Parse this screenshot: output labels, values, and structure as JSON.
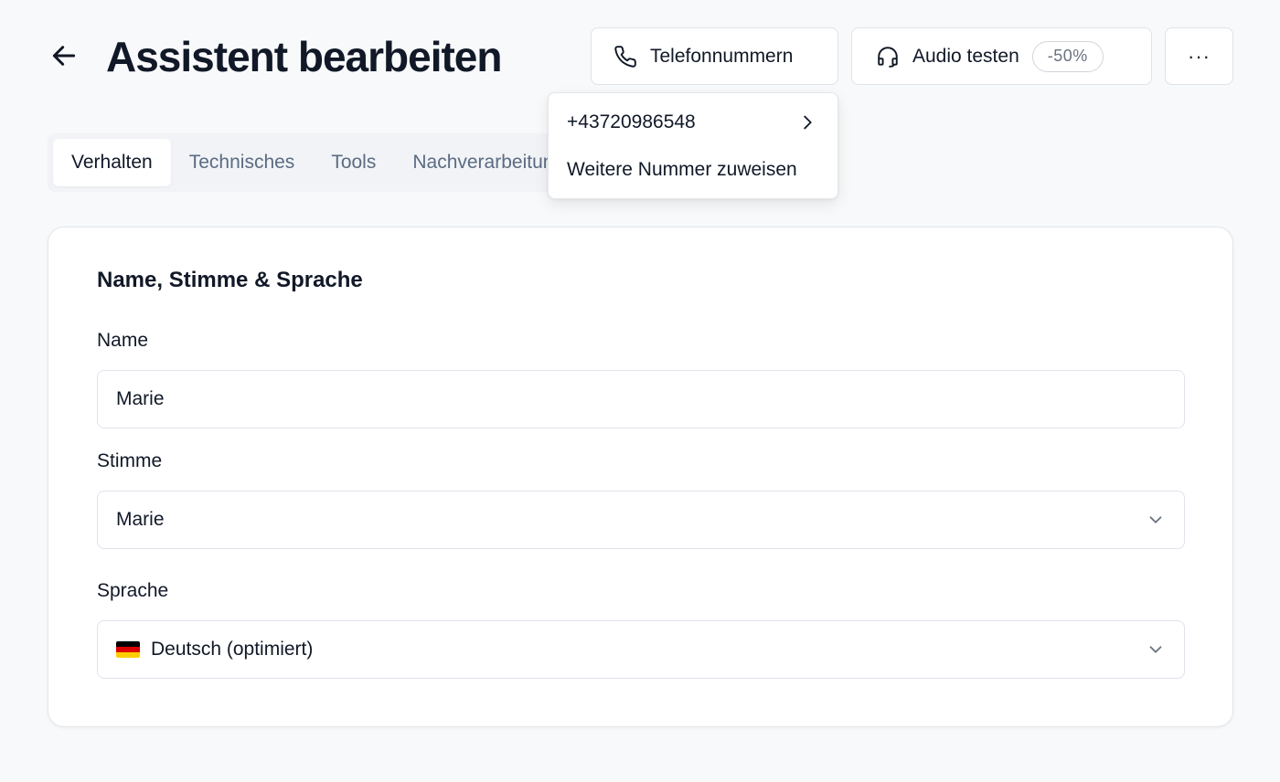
{
  "header": {
    "title": "Assistent bearbeiten",
    "back_icon": "arrow-left-icon",
    "phone_button": {
      "label": "Telefonnummern",
      "icon": "phone-icon"
    },
    "audio_button": {
      "label": "Audio testen",
      "icon": "headphones-icon",
      "badge": "-50%"
    },
    "more_button": {
      "label": "···",
      "icon": "ellipsis-icon"
    }
  },
  "tabs": [
    {
      "label": "Verhalten",
      "active": true
    },
    {
      "label": "Technisches"
    },
    {
      "label": "Tools"
    },
    {
      "label": "Nachverarbeitung"
    }
  ],
  "phone_dropdown": {
    "items": [
      {
        "label": "+43720986548",
        "icon": "chevron-right-icon"
      },
      {
        "label": "Weitere Nummer zuweisen"
      }
    ]
  },
  "card": {
    "title": "Name, Stimme & Sprache",
    "fields": {
      "name": {
        "label": "Name",
        "value": "Marie"
      },
      "voice": {
        "label": "Stimme",
        "value": "Marie",
        "icon": "chevron-down-icon"
      },
      "language": {
        "label": "Sprache",
        "value": "Deutsch (optimiert)",
        "flag": "german-flag-icon",
        "icon": "chevron-down-icon"
      }
    }
  },
  "colors": {
    "background": "#f8f9fa",
    "text": "#111827",
    "tab_inactive": "#5b6b82",
    "border": "#dfe3ea"
  }
}
